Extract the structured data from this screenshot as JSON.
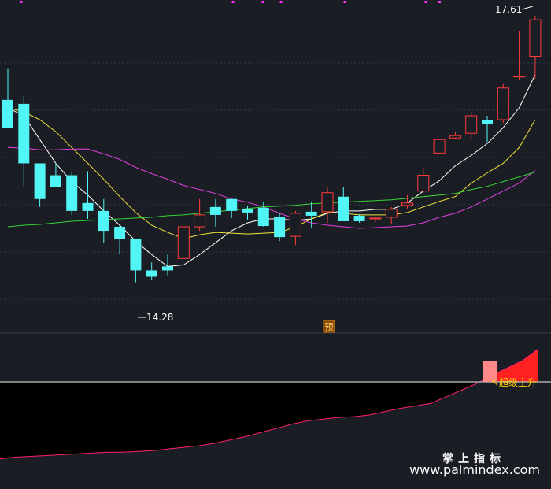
{
  "chart_data": [
    {
      "type": "candlestick",
      "panel": "main",
      "title": "",
      "annotations": {
        "high_label": "17.61",
        "low_label": "14.28",
        "signal_tag": "预"
      },
      "colors": {
        "up": "#ff3b3b",
        "down": "#52f5f5",
        "ma_white": "#ffffff",
        "ma_yellow": "#f4e63a",
        "ma_magenta": "#e040e0",
        "ma_green": "#34d634",
        "marker": "#ff33ff",
        "tag_bg": "#8a4a00"
      },
      "ylim": [
        13.6,
        17.75
      ],
      "candles": [
        {
          "o": 16.55,
          "h": 16.95,
          "l": 16.2,
          "c": 16.2
        },
        {
          "o": 16.5,
          "h": 16.6,
          "l": 15.45,
          "c": 15.75
        },
        {
          "o": 15.75,
          "h": 15.75,
          "l": 15.2,
          "c": 15.3
        },
        {
          "o": 15.6,
          "h": 15.75,
          "l": 15.5,
          "c": 15.45
        },
        {
          "o": 15.6,
          "h": 15.65,
          "l": 15.1,
          "c": 15.15
        },
        {
          "o": 15.25,
          "h": 15.65,
          "l": 15.05,
          "c": 15.15
        },
        {
          "o": 15.15,
          "h": 15.3,
          "l": 14.75,
          "c": 14.9
        },
        {
          "o": 14.95,
          "h": 14.97,
          "l": 14.6,
          "c": 14.8
        },
        {
          "o": 14.8,
          "h": 14.8,
          "l": 14.25,
          "c": 14.4
        },
        {
          "o": 14.4,
          "h": 14.5,
          "l": 14.28,
          "c": 14.32
        },
        {
          "o": 14.45,
          "h": 14.6,
          "l": 14.34,
          "c": 14.4
        },
        {
          "o": 14.55,
          "h": 14.95,
          "l": 14.55,
          "c": 14.95
        },
        {
          "o": 14.95,
          "h": 15.3,
          "l": 14.9,
          "c": 15.1
        },
        {
          "o": 15.2,
          "h": 15.3,
          "l": 14.95,
          "c": 15.1
        },
        {
          "o": 15.3,
          "h": 15.3,
          "l": 15.06,
          "c": 15.15
        },
        {
          "o": 15.17,
          "h": 15.22,
          "l": 15.04,
          "c": 15.13
        },
        {
          "o": 15.19,
          "h": 15.27,
          "l": 14.95,
          "c": 14.96
        },
        {
          "o": 15.07,
          "h": 15.13,
          "l": 14.77,
          "c": 14.82
        },
        {
          "o": 14.83,
          "h": 15.15,
          "l": 14.72,
          "c": 15.12
        },
        {
          "o": 15.14,
          "h": 15.27,
          "l": 14.93,
          "c": 15.09
        },
        {
          "o": 15.14,
          "h": 15.45,
          "l": 15.0,
          "c": 15.38
        },
        {
          "o": 15.33,
          "h": 15.45,
          "l": 15.05,
          "c": 15.02
        },
        {
          "o": 15.09,
          "h": 15.11,
          "l": 15.0,
          "c": 15.02
        },
        {
          "o": 15.05,
          "h": 15.07,
          "l": 15.01,
          "c": 15.06
        },
        {
          "o": 15.07,
          "h": 15.2,
          "l": 14.98,
          "c": 15.17
        },
        {
          "o": 15.22,
          "h": 15.35,
          "l": 15.18,
          "c": 15.25
        },
        {
          "o": 15.4,
          "h": 15.7,
          "l": 15.38,
          "c": 15.6
        },
        {
          "o": 15.88,
          "h": 16.05,
          "l": 15.87,
          "c": 16.05
        },
        {
          "o": 16.07,
          "h": 16.15,
          "l": 16.05,
          "c": 16.1
        },
        {
          "o": 16.13,
          "h": 16.4,
          "l": 16.05,
          "c": 16.35
        },
        {
          "o": 16.3,
          "h": 16.35,
          "l": 16.02,
          "c": 16.25
        },
        {
          "o": 16.3,
          "h": 16.75,
          "l": 16.26,
          "c": 16.7
        },
        {
          "o": 16.85,
          "h": 17.42,
          "l": 16.8,
          "c": 16.85
        },
        {
          "o": 17.1,
          "h": 17.61,
          "l": 16.82,
          "c": 17.56
        }
      ],
      "moving_averages": [
        {
          "color": "white",
          "values": [
            16.45,
            16.35,
            16.05,
            15.75,
            15.52,
            15.35,
            15.15,
            14.97,
            14.77,
            14.6,
            14.45,
            14.47,
            14.6,
            14.75,
            14.9,
            15.0,
            15.05,
            15.05,
            15.03,
            15.05,
            15.12,
            15.15,
            15.15,
            15.17,
            15.17,
            15.25,
            15.4,
            15.53,
            15.72,
            15.85,
            16.0,
            16.2,
            16.45,
            16.87
          ]
        },
        {
          "color": "yellow",
          "values": [
            16.45,
            16.4,
            16.3,
            16.15,
            15.95,
            15.75,
            15.55,
            15.33,
            15.13,
            14.97,
            14.88,
            14.8,
            14.85,
            14.88,
            14.87,
            14.86,
            14.87,
            14.88,
            14.95,
            15.05,
            15.13,
            15.12,
            15.1,
            15.1,
            15.1,
            15.13,
            15.2,
            15.27,
            15.33,
            15.5,
            15.63,
            15.75,
            15.95,
            16.3
          ]
        },
        {
          "color": "magenta",
          "values": [
            15.95,
            15.94,
            15.92,
            15.92,
            15.93,
            15.93,
            15.87,
            15.8,
            15.7,
            15.62,
            15.55,
            15.47,
            15.42,
            15.37,
            15.3,
            15.26,
            15.2,
            15.12,
            15.05,
            15.0,
            14.97,
            14.95,
            14.93,
            14.94,
            14.95,
            14.96,
            15.0,
            15.07,
            15.12,
            15.2,
            15.3,
            15.4,
            15.5,
            15.66
          ]
        },
        {
          "color": "green",
          "values": [
            14.95,
            14.97,
            14.98,
            15.0,
            15.02,
            15.03,
            15.04,
            15.05,
            15.06,
            15.07,
            15.09,
            15.1,
            15.12,
            15.14,
            15.16,
            15.18,
            15.2,
            15.21,
            15.22,
            15.24,
            15.25,
            15.26,
            15.27,
            15.28,
            15.29,
            15.31,
            15.33,
            15.35,
            15.37,
            15.42,
            15.46,
            15.52,
            15.58,
            15.64
          ]
        }
      ]
    },
    {
      "type": "area",
      "panel": "indicator",
      "title": "",
      "annotations": {
        "signal_label": "超级主升"
      },
      "colors": {
        "base_line": "#aaaaaa",
        "area_above": "#ff2020",
        "area_below": "#000000",
        "line": "#ff2070",
        "highlight_bar": "#ff8888",
        "label": "#ffd000"
      },
      "ylim": [
        -100,
        40
      ],
      "values": [
        -93,
        -91,
        -90,
        -89,
        -88,
        -87,
        -86,
        -85,
        -85,
        -84,
        -83,
        -81,
        -79,
        -77,
        -74,
        -70,
        -66,
        -61,
        -56,
        -51,
        -47,
        -45,
        -43,
        -42,
        -40,
        -36,
        -32,
        -29,
        -26,
        -18,
        -10,
        -2,
        8,
        17,
        26,
        40
      ],
      "highlight_index": 30
    }
  ],
  "watermark": {
    "line1": "掌上指标",
    "line2": "www.palmindex.com"
  }
}
